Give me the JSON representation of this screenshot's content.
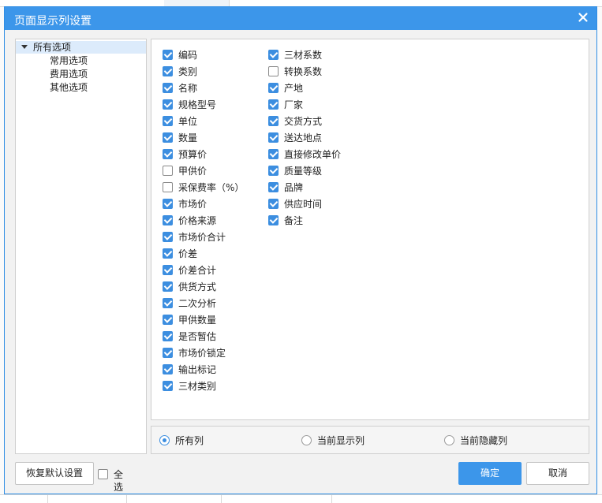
{
  "dialog": {
    "title": "页面显示列设置",
    "close_symbol": "×"
  },
  "tree": {
    "root_label": "所有选项",
    "children": [
      "常用选项",
      "费用选项",
      "其他选项"
    ]
  },
  "columns_left": [
    {
      "label": "编码",
      "checked": true
    },
    {
      "label": "类别",
      "checked": true
    },
    {
      "label": "名称",
      "checked": true
    },
    {
      "label": "规格型号",
      "checked": true
    },
    {
      "label": "单位",
      "checked": true
    },
    {
      "label": "数量",
      "checked": true
    },
    {
      "label": "预算价",
      "checked": true
    },
    {
      "label": "甲供价",
      "checked": false
    },
    {
      "label": "采保费率（%）",
      "checked": false
    },
    {
      "label": "市场价",
      "checked": true
    },
    {
      "label": "价格来源",
      "checked": true
    },
    {
      "label": "市场价合计",
      "checked": true
    },
    {
      "label": "价差",
      "checked": true
    },
    {
      "label": "价差合计",
      "checked": true
    },
    {
      "label": "供货方式",
      "checked": true
    },
    {
      "label": "二次分析",
      "checked": true
    },
    {
      "label": "甲供数量",
      "checked": true
    },
    {
      "label": "是否暂估",
      "checked": true
    },
    {
      "label": "市场价锁定",
      "checked": true
    },
    {
      "label": "输出标记",
      "checked": true
    },
    {
      "label": "三材类别",
      "checked": true
    }
  ],
  "columns_right": [
    {
      "label": "三材系数",
      "checked": true
    },
    {
      "label": "转换系数",
      "checked": false
    },
    {
      "label": "产地",
      "checked": true
    },
    {
      "label": "厂家",
      "checked": true
    },
    {
      "label": "交货方式",
      "checked": true
    },
    {
      "label": "送达地点",
      "checked": true
    },
    {
      "label": "直接修改单价",
      "checked": true
    },
    {
      "label": "质量等级",
      "checked": true
    },
    {
      "label": "品牌",
      "checked": true
    },
    {
      "label": "供应时间",
      "checked": true
    },
    {
      "label": "备注",
      "checked": true
    }
  ],
  "view_filter": {
    "options": [
      "所有列",
      "当前显示列",
      "当前隐藏列"
    ],
    "selected_index": 0
  },
  "footer": {
    "restore_label": "恢复默认设置",
    "select_all_label": "全选",
    "select_all_checked": false,
    "ok_label": "确定",
    "cancel_label": "取消"
  },
  "colors": {
    "accent": "#3c96ea",
    "checkbox": "#3c8ee0",
    "tree_selected_bg": "#dcebfb"
  }
}
